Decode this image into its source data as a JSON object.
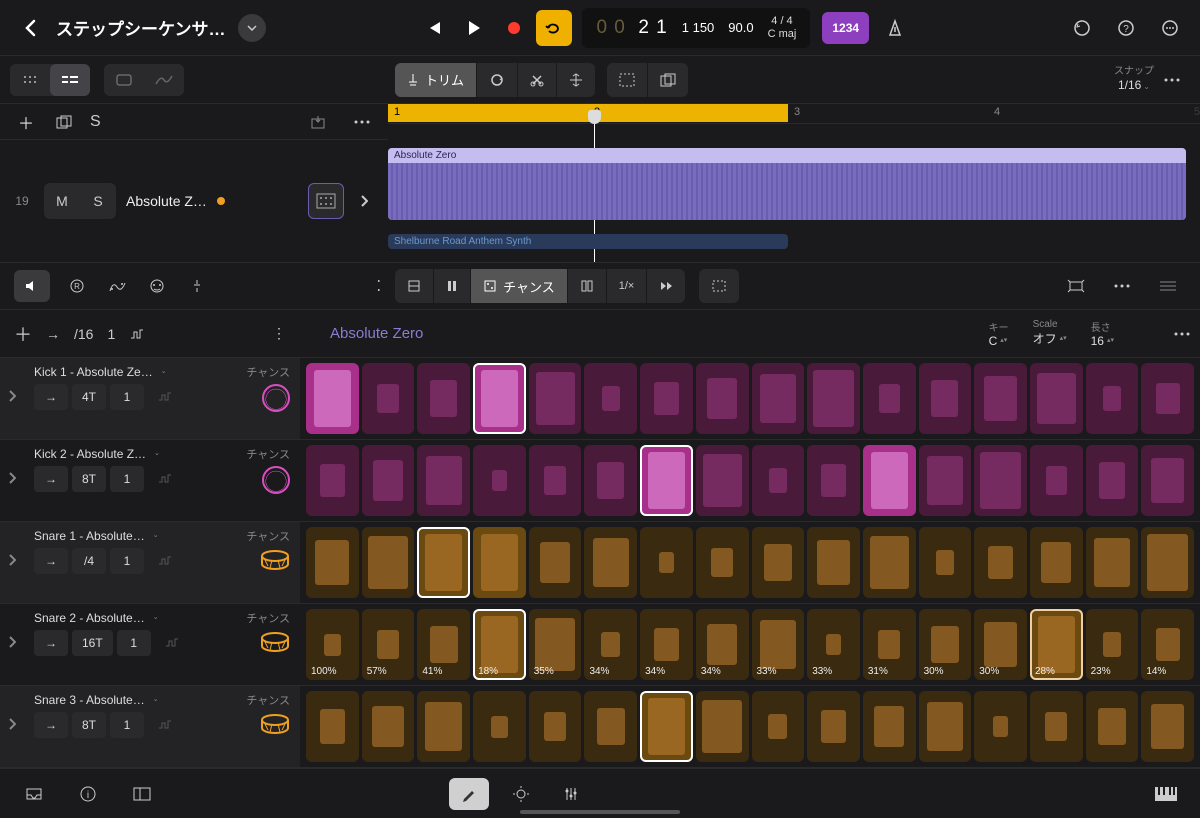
{
  "header": {
    "title": "ステップシーケンサ…",
    "lcd_faint": "0 0",
    "lcd_bright": "2 1",
    "lcd_beat_sub": "1 150",
    "tempo": "90.0",
    "timesig": "4 / 4",
    "key": "C maj",
    "tuning": "1234"
  },
  "toolbar": {
    "trim": "トリム",
    "snap_label": "スナップ",
    "snap_value": "1/16"
  },
  "tracks": {
    "add": "+",
    "solo": "S",
    "row_num": "19",
    "mute": "M",
    "solo2": "S",
    "name": "Absolute Z…",
    "region1": "Absolute Zero",
    "region2": "Shelburne Road Anthem Synth",
    "ruler": [
      "1",
      "2",
      "3",
      "4",
      "5"
    ]
  },
  "seq_toolbar": {
    "chance": "チャンス"
  },
  "seq_header": {
    "pattern": "Absolute Zero",
    "div": "/16",
    "one": "1",
    "key_lbl": "キー",
    "key_v": "C",
    "scale_lbl": "Scale",
    "scale_v": "オフ",
    "len_lbl": "長さ",
    "len_v": "16"
  },
  "rows": [
    {
      "name": "Kick 1 - Absolute Ze…",
      "chance": "チャンス",
      "rate": "4T",
      "one": "1",
      "color": "pink",
      "icon": "kick",
      "steps": [
        2,
        1,
        1,
        3,
        1,
        1,
        1,
        1,
        1,
        1,
        1,
        1,
        1,
        1,
        1,
        1
      ]
    },
    {
      "name": "Kick 2 - Absolute Z…",
      "chance": "チャンス",
      "rate": "8T",
      "one": "1",
      "color": "pink",
      "icon": "kick",
      "steps": [
        1,
        1,
        1,
        1,
        1,
        1,
        3,
        1,
        1,
        1,
        2,
        1,
        1,
        1,
        1,
        1
      ]
    },
    {
      "name": "Snare 1 - Absolute…",
      "chance": "チャンス",
      "rate": "/4",
      "one": "1",
      "color": "orange",
      "icon": "snare",
      "steps": [
        1,
        1,
        3,
        2,
        1,
        1,
        1,
        1,
        1,
        1,
        1,
        1,
        1,
        1,
        1,
        1
      ]
    },
    {
      "name": "Snare 2 - Absolute…",
      "chance": "チャンス",
      "rate": "16T",
      "one": "1",
      "color": "orange",
      "icon": "snare",
      "steps": [
        1,
        1,
        1,
        3,
        1,
        1,
        1,
        1,
        1,
        1,
        1,
        1,
        1,
        4,
        1,
        1
      ],
      "pct": [
        "100%",
        "57%",
        "41%",
        "18%",
        "35%",
        "34%",
        "34%",
        "34%",
        "33%",
        "33%",
        "31%",
        "30%",
        "30%",
        "28%",
        "23%",
        "14%"
      ]
    },
    {
      "name": "Snare 3 - Absolute…",
      "chance": "チャンス",
      "rate": "8T",
      "one": "1",
      "color": "orange",
      "icon": "snare",
      "steps": [
        1,
        1,
        1,
        1,
        1,
        1,
        3,
        1,
        1,
        1,
        1,
        1,
        1,
        1,
        1,
        1
      ]
    }
  ]
}
